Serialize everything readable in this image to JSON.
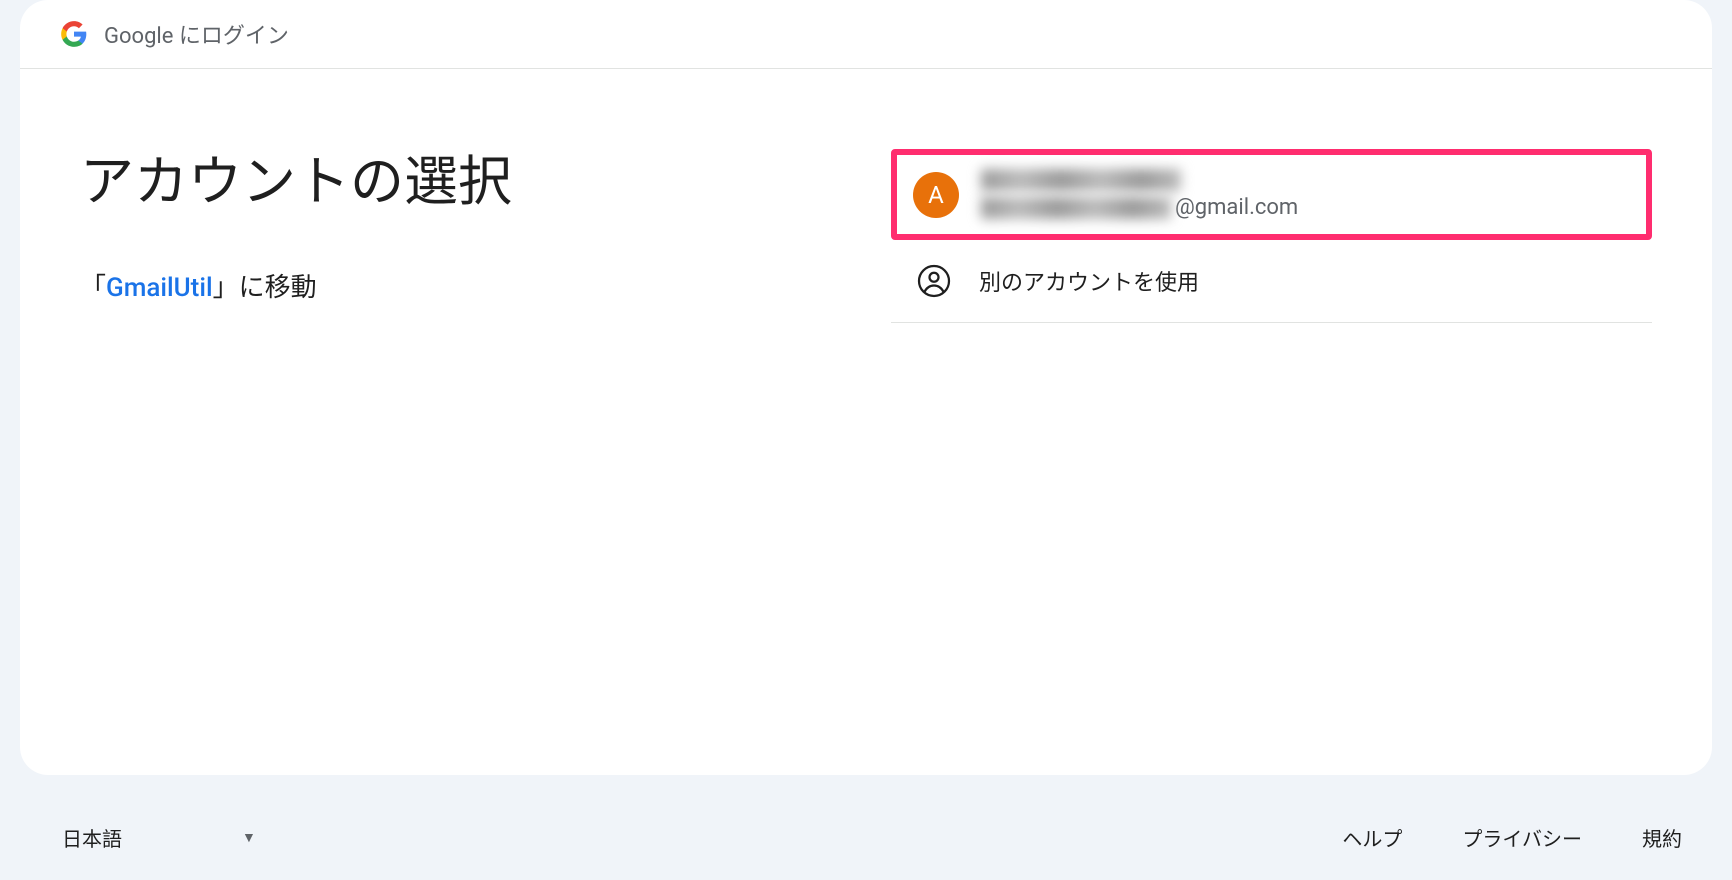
{
  "header": {
    "title": "Google にログイン"
  },
  "main": {
    "heading": "アカウントの選択",
    "subtitle_prefix": "「",
    "app_name": "GmailUtil",
    "subtitle_suffix": "」に移動"
  },
  "accounts": {
    "item1": {
      "avatar_letter": "A",
      "email_suffix": "@gmail.com",
      "avatar_color": "#e8710a"
    },
    "use_another": "別のアカウントを使用"
  },
  "footer": {
    "language": "日本語",
    "links": {
      "help": "ヘルプ",
      "privacy": "プライバシー",
      "terms": "規約"
    }
  }
}
